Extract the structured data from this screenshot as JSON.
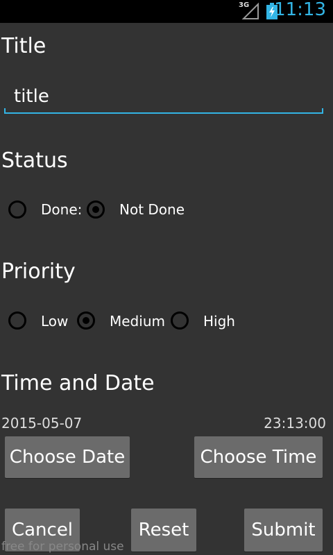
{
  "statusbar": {
    "network": "3G",
    "time": "11:13",
    "icons": [
      "signal-icon",
      "battery-charging-icon"
    ]
  },
  "form": {
    "title_heading": "Title",
    "title_value": "title",
    "status_heading": "Status",
    "status_options": [
      {
        "label": "Done:",
        "checked": false
      },
      {
        "label": "Not Done",
        "checked": true
      }
    ],
    "priority_heading": "Priority",
    "priority_options": [
      {
        "label": "Low",
        "checked": false
      },
      {
        "label": "Medium",
        "checked": true
      },
      {
        "label": "High",
        "checked": false
      }
    ],
    "time_date_heading": "Time and Date",
    "date_value": "2015-05-07",
    "time_value": "23:13:00"
  },
  "buttons": {
    "choose_date": "Choose Date",
    "choose_time": "Choose Time",
    "cancel": "Cancel",
    "reset": "Reset",
    "submit": "Submit"
  },
  "watermark": "free for personal use",
  "colors": {
    "background": "#333333",
    "accent": "#33b5e5",
    "button": "#6b6b6b"
  }
}
